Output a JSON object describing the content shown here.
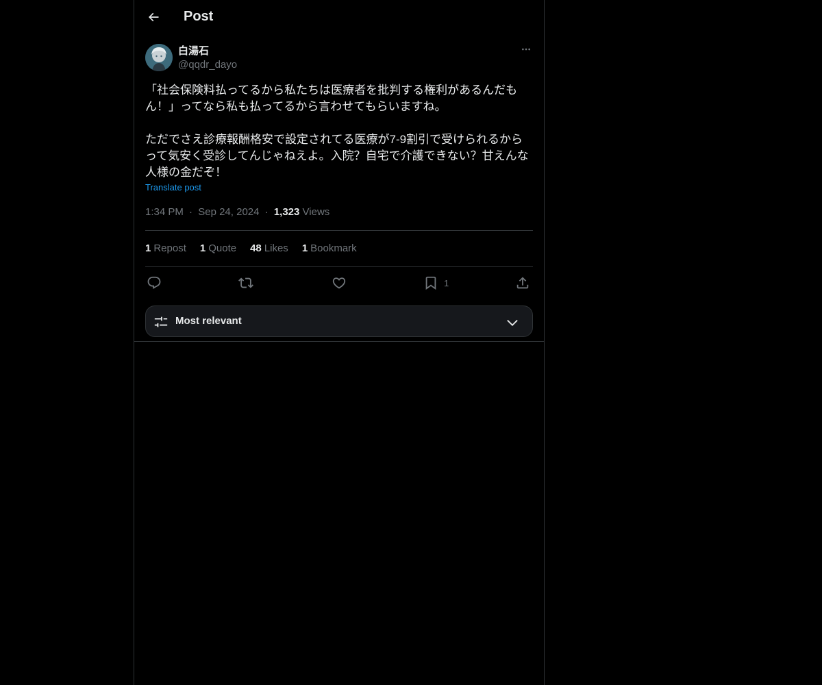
{
  "header": {
    "title": "Post",
    "back_icon": "arrow-left-icon"
  },
  "post": {
    "author": {
      "display_name": "白湯石",
      "handle": "@qqdr_dayo"
    },
    "text": "「社会保険料払ってるから私たちは医療者を批判する権利があるんだもん！」ってなら私も払ってるから言わせてもらいますね。\n\nただでさえ診療報酬格安で設定されてる医療が7-9割引で受けられるからって気安く受診してんじゃねえよ。入院？自宅で介護できない？甘えんな人様の金だぞ！",
    "translate_label": "Translate post",
    "time": "1:34 PM",
    "date": "Sep 24, 2024",
    "views_count": "1,323",
    "views_label": "Views",
    "separator": "·"
  },
  "stats": [
    {
      "count": "1",
      "label": "Repost"
    },
    {
      "count": "1",
      "label": "Quote"
    },
    {
      "count": "48",
      "label": "Likes"
    },
    {
      "count": "1",
      "label": "Bookmark"
    }
  ],
  "actions": {
    "reply_icon": "reply-icon",
    "repost_icon": "repost-icon",
    "like_icon": "heart-icon",
    "bookmark_icon": "bookmark-icon",
    "bookmark_count": "1",
    "share_icon": "share-icon"
  },
  "sort": {
    "label": "Most relevant",
    "icon": "sliders-icon",
    "chevron": "chevron-down-icon"
  },
  "colors": {
    "background": "#000000",
    "text": "#e7e9ea",
    "muted": "#71767b",
    "link": "#1d9bf0",
    "border": "#2f3336"
  }
}
